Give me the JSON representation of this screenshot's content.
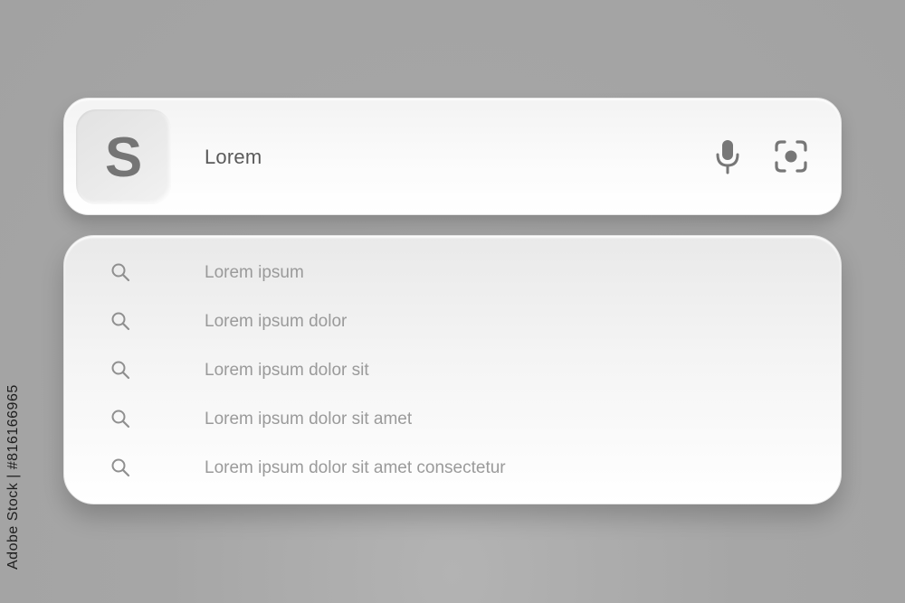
{
  "search_bar": {
    "logo_letter": "S",
    "query": "Lorem",
    "icons": {
      "voice": "microphone-icon",
      "visual_search": "camera-lens-icon"
    }
  },
  "suggestions": [
    {
      "label": "Lorem ipsum",
      "icon": "search-icon"
    },
    {
      "label": "Lorem ipsum dolor",
      "icon": "search-icon"
    },
    {
      "label": "Lorem ipsum dolor sit",
      "icon": "search-icon"
    },
    {
      "label": "Lorem ipsum dolor sit amet",
      "icon": "search-icon"
    },
    {
      "label": "Lorem ipsum dolor sit amet consectetur",
      "icon": "search-icon"
    }
  ],
  "side_text": "Adobe Stock | #816166965",
  "colors": {
    "background": "#a6a6a6",
    "card": "#f7f7f7",
    "logo_tile": "#e8e8e8",
    "logo_letter": "#757575",
    "query_text": "#5a5a5a",
    "suggestion_text": "#9a9a9a",
    "icon": "#777777"
  }
}
